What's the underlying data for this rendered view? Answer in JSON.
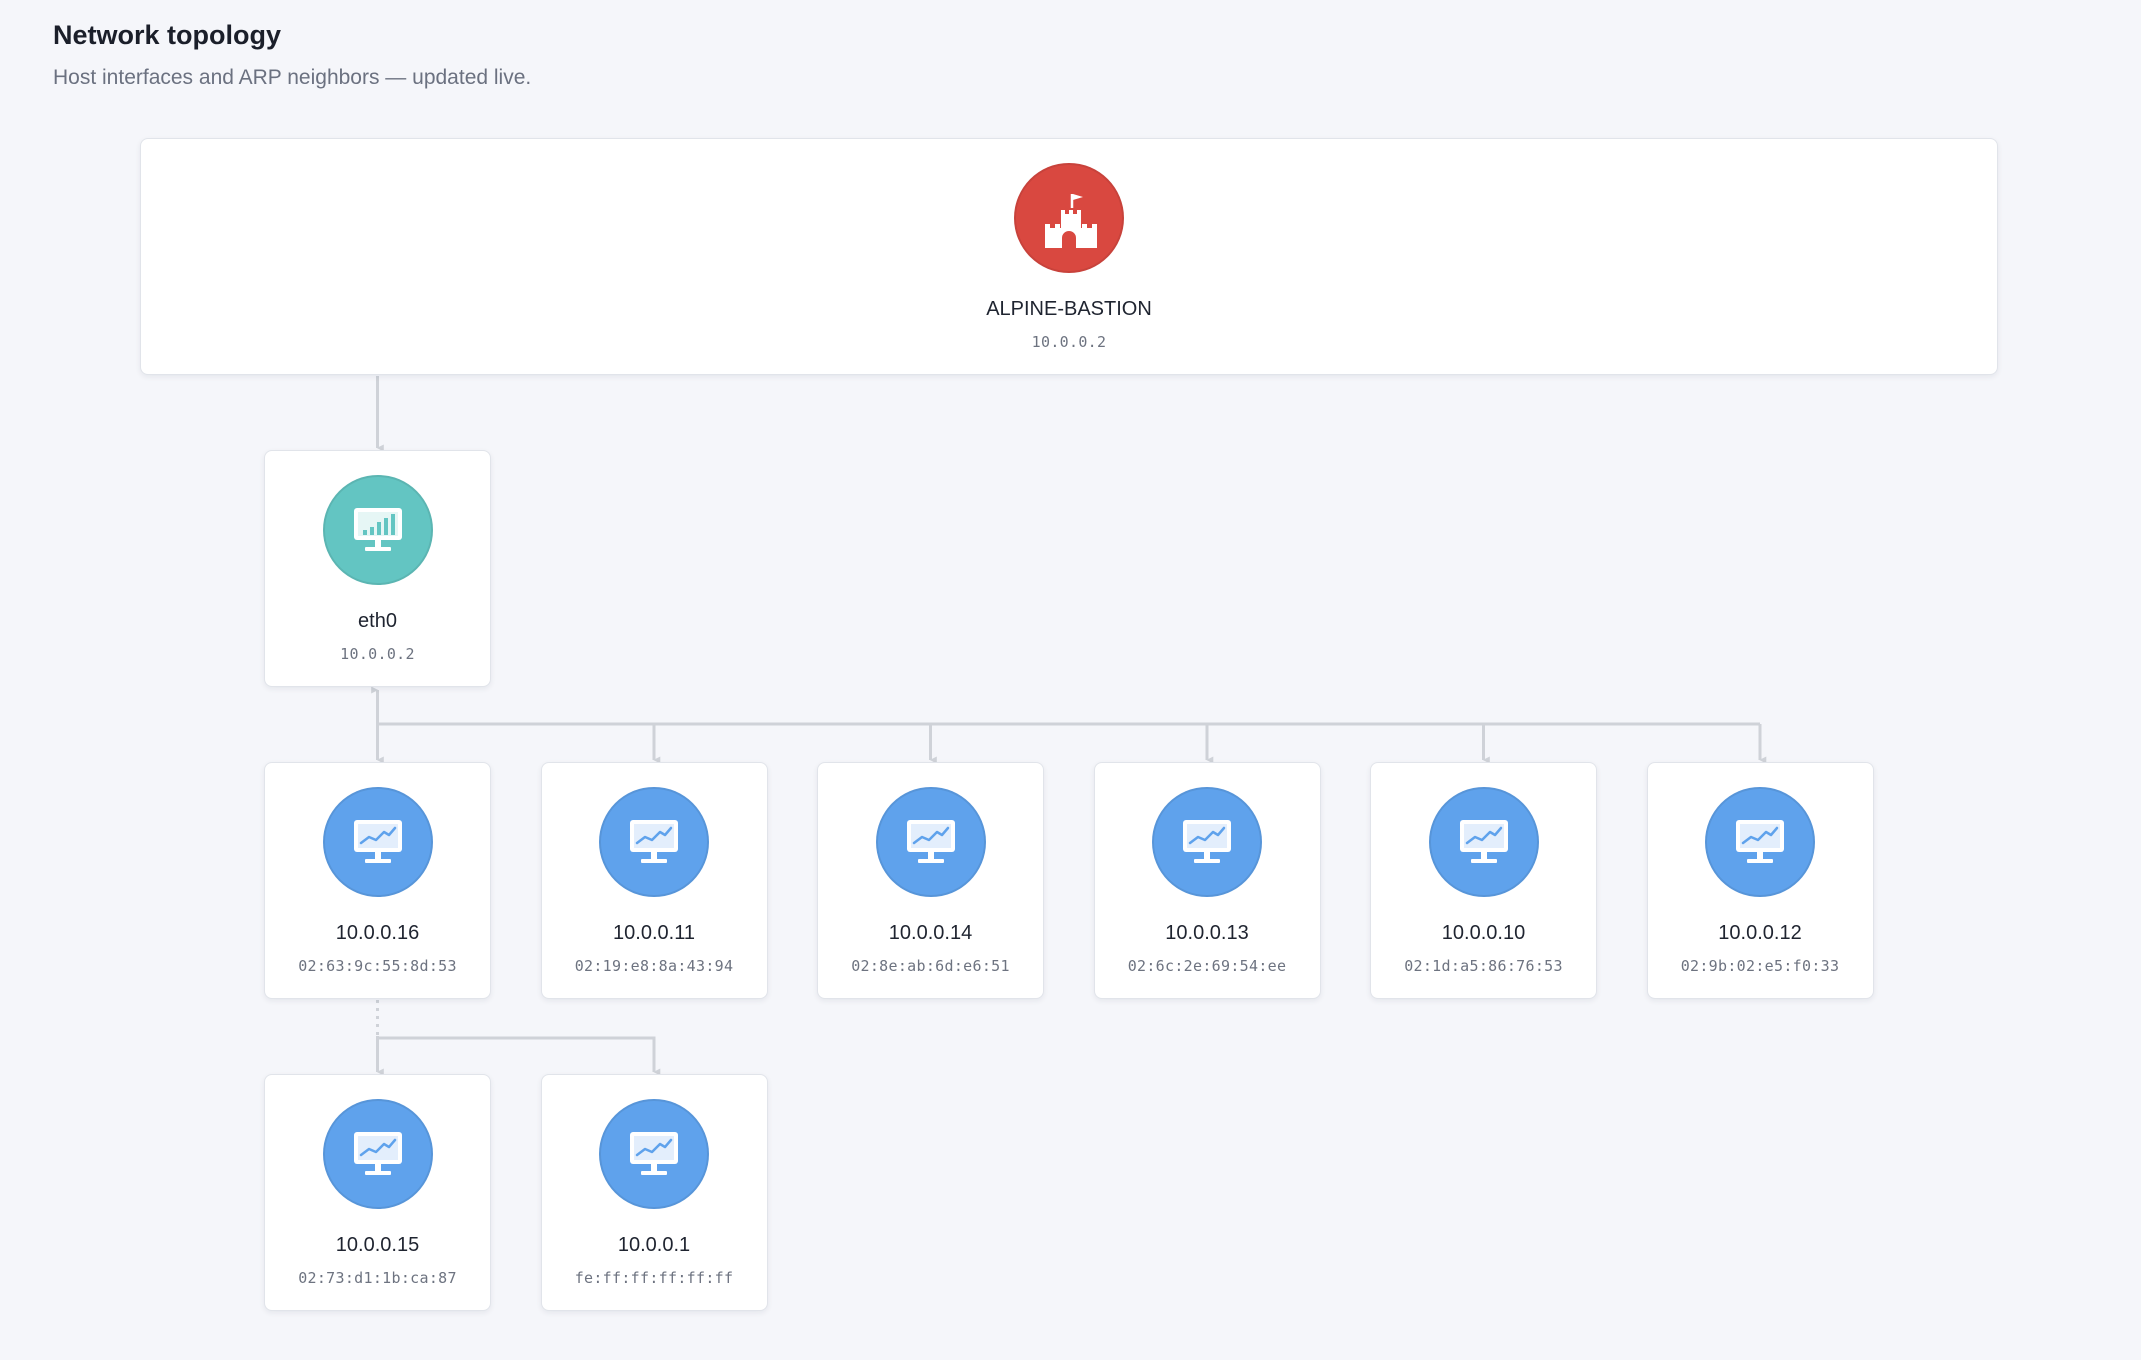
{
  "header": {
    "title": "Network topology",
    "subtitle": "Host interfaces and ARP neighbors — updated live."
  },
  "colors": {
    "host": "#d94840",
    "interface": "#63c5c2",
    "neighbor": "#5fa2ec",
    "edge": "#cfd2d8"
  },
  "host": {
    "label": "ALPINE-BASTION",
    "ip": "10.0.0.2",
    "icon": "castle-icon"
  },
  "interfaces": [
    {
      "label": "eth0",
      "ip": "10.0.0.2",
      "icon": "monitor-bar-chart-icon"
    }
  ],
  "neighbors": [
    {
      "label": "10.0.0.16",
      "mac": "02:63:9c:55:8d:53",
      "icon": "monitor-line-chart-icon"
    },
    {
      "label": "10.0.0.11",
      "mac": "02:19:e8:8a:43:94",
      "icon": "monitor-line-chart-icon"
    },
    {
      "label": "10.0.0.14",
      "mac": "02:8e:ab:6d:e6:51",
      "icon": "monitor-line-chart-icon"
    },
    {
      "label": "10.0.0.13",
      "mac": "02:6c:2e:69:54:ee",
      "icon": "monitor-line-chart-icon"
    },
    {
      "label": "10.0.0.10",
      "mac": "02:1d:a5:86:76:53",
      "icon": "monitor-line-chart-icon"
    },
    {
      "label": "10.0.0.12",
      "mac": "02:9b:02:e5:f0:33",
      "icon": "monitor-line-chart-icon"
    },
    {
      "label": "10.0.0.15",
      "mac": "02:73:d1:1b:ca:87",
      "icon": "monitor-line-chart-icon"
    },
    {
      "label": "10.0.0.1",
      "mac": "fe:ff:ff:ff:ff:ff",
      "icon": "monitor-line-chart-icon"
    }
  ]
}
